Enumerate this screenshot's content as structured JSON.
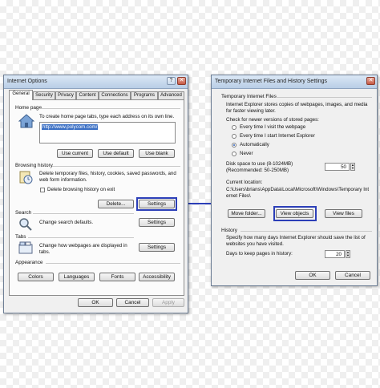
{
  "internet_options": {
    "title": "Internet Options",
    "tabs": [
      "General",
      "Security",
      "Privacy",
      "Content",
      "Connections",
      "Programs",
      "Advanced"
    ],
    "home_page": {
      "group": "Home page",
      "desc": "To create home page tabs, type each address on its own line.",
      "url": "http://www.polycom.com/",
      "use_current": "Use current",
      "use_default": "Use default",
      "use_blank": "Use blank"
    },
    "browsing_history": {
      "group": "Browsing history",
      "desc": "Delete temporary files, history, cookies, saved passwords, and web form information.",
      "checkbox": "Delete browsing history on exit",
      "delete": "Delete...",
      "settings": "Settings"
    },
    "search": {
      "group": "Search",
      "desc": "Change search defaults.",
      "settings": "Settings"
    },
    "tabs_group": {
      "group": "Tabs",
      "desc": "Change how webpages are displayed in tabs.",
      "settings": "Settings"
    },
    "appearance": {
      "group": "Appearance",
      "colors": "Colors",
      "languages": "Languages",
      "fonts": "Fonts",
      "accessibility": "Accessibility"
    },
    "ok": "OK",
    "cancel": "Cancel",
    "apply": "Apply"
  },
  "temp_files": {
    "title": "Temporary Internet Files and History Settings",
    "group": "Temporary Internet Files",
    "desc": "Internet Explorer stores copies of webpages, images, and media for faster viewing later.",
    "check_label": "Check for newer versions of stored pages:",
    "options": [
      "Every time I visit the webpage",
      "Every time I start Internet Explorer",
      "Automatically",
      "Never"
    ],
    "disk_label_1": "Disk space to use (8-1024MB)",
    "disk_label_2": "(Recommended: 50-250MB)",
    "disk_value": "50",
    "current_location_label": "Current location:",
    "current_location": "C:\\Users\\brians\\AppData\\Local\\Microsoft\\Windows\\Temporary Internet Files\\",
    "move_folder": "Move folder...",
    "view_objects": "View objects",
    "view_files": "View files",
    "history_group": "History",
    "history_desc": "Specify how many days Internet Explorer should save the list of websites you have visited.",
    "days_label": "Days to keep pages in history:",
    "days_value": "20",
    "ok": "OK",
    "cancel": "Cancel"
  },
  "highlight_color": "#2c3fb8"
}
